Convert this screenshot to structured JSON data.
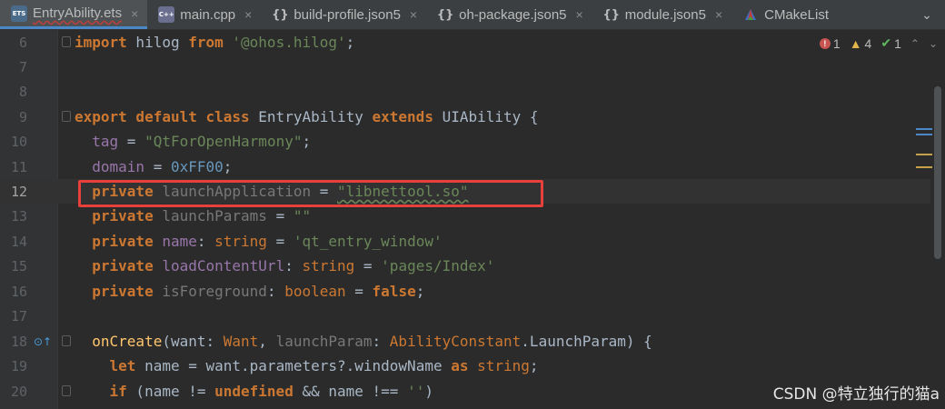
{
  "tabs": [
    {
      "label": "EntryAbility.ets",
      "icon": "ets-file-icon",
      "active": true
    },
    {
      "label": "main.cpp",
      "icon": "cpp-file-icon",
      "active": false
    },
    {
      "label": "build-profile.json5",
      "icon": "json-file-icon",
      "active": false
    },
    {
      "label": "oh-package.json5",
      "icon": "json-file-icon",
      "active": false
    },
    {
      "label": "module.json5",
      "icon": "json-file-icon",
      "active": false
    },
    {
      "label": "CMakeList",
      "icon": "cmake-file-icon",
      "active": false
    }
  ],
  "icon_labels": {
    "ets": "ETS",
    "cpp": "C++",
    "json": "{}"
  },
  "tab_close_glyph": "×",
  "tab_more_glyph": "⌄",
  "inspection": {
    "errors": "1",
    "warnings": "4",
    "weak": "1"
  },
  "lines": [
    {
      "num": "6"
    },
    {
      "num": "7"
    },
    {
      "num": "8"
    },
    {
      "num": "9"
    },
    {
      "num": "10"
    },
    {
      "num": "11"
    },
    {
      "num": "12"
    },
    {
      "num": "13"
    },
    {
      "num": "14"
    },
    {
      "num": "15"
    },
    {
      "num": "16"
    },
    {
      "num": "17"
    },
    {
      "num": "18"
    },
    {
      "num": "19"
    },
    {
      "num": "20"
    }
  ],
  "code": {
    "l6": {
      "kw1": "import",
      "id": " hilog ",
      "kw2": "from",
      "str": " '@ohos.hilog'",
      "end": ";"
    },
    "l9": {
      "kw": "export default class",
      "cls": " EntryAbility ",
      "kw2": "extends",
      "cls2": " UIAbility ",
      "brace": "{"
    },
    "l10": {
      "prop": "  tag",
      "eq": " = ",
      "str": "\"QtForOpenHarmony\"",
      "end": ";"
    },
    "l11": {
      "prop": "  domain",
      "eq": " = ",
      "num": "0xFF00",
      "end": ";"
    },
    "l12": {
      "kw": "  private",
      "prop": " launchApplication",
      "eq": " = ",
      "str": "\"libnettool.so\""
    },
    "l13": {
      "kw": "  private",
      "prop": " launchParams",
      "eq": " = ",
      "str": "\"\""
    },
    "l14": {
      "kw": "  private",
      "prop": " name",
      "colon": ": ",
      "type": "string",
      "eq": " = ",
      "str": "'qt_entry_window'"
    },
    "l15": {
      "kw": "  private",
      "prop": " loadContentUrl",
      "colon": ": ",
      "type": "string",
      "eq": " = ",
      "str": "'pages/Index'"
    },
    "l16": {
      "kw": "  private",
      "prop": " isForeground",
      "colon": ": ",
      "type": "boolean",
      "eq": " = ",
      "val": "false",
      "end": ";"
    },
    "l18": {
      "fn": "  onCreate",
      "p1": "(want",
      "c1": ": ",
      "t1": "Want",
      "sep": ", ",
      "p2": "launchParam",
      "c2": ": ",
      "t2": "AbilityConstant",
      "dot": ".LaunchParam) ",
      "brace": "{"
    },
    "l19": {
      "kw": "    let",
      "id": " name = want.parameters?.windowName ",
      "kw2": "as",
      "type": " string",
      "end": ";"
    },
    "l20": {
      "kw": "    if",
      "p": " (name != ",
      "kw2": "undefined",
      "mid": " && name !== ",
      "str": "''",
      "close": ")"
    }
  },
  "gutter_icon_l18": "⊙↑",
  "watermark": "CSDN @特立独行的猫a",
  "colors": {
    "highlight": "#e8403a",
    "error": "#c75450",
    "warning": "#e0b54b"
  }
}
